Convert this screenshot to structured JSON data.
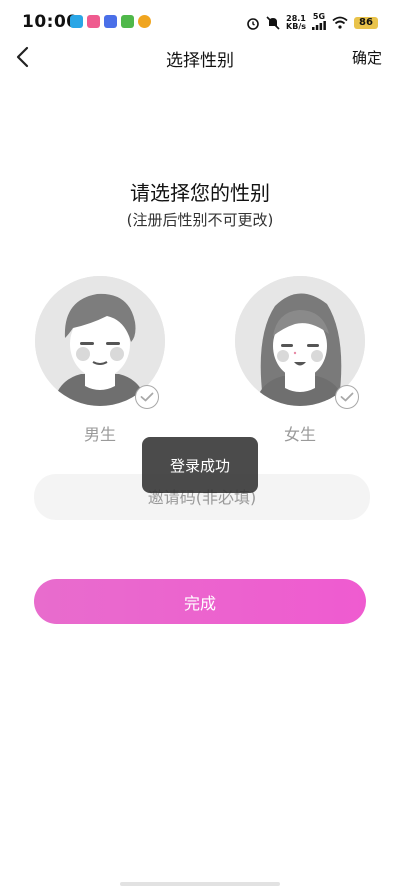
{
  "status_bar": {
    "time": "10:00",
    "network_speed": "28.1",
    "network_unit": "KB/s",
    "signal_type": "5G",
    "battery": "86",
    "battery_color": "#e9c34b"
  },
  "nav": {
    "title": "选择性别",
    "confirm_label": "确定"
  },
  "main": {
    "heading": "请选择您的性别",
    "subheading": "(注册后性别不可更改)",
    "options": [
      {
        "label": "男生",
        "icon": "male-avatar-icon"
      },
      {
        "label": "女生",
        "icon": "female-avatar-icon"
      }
    ],
    "invite_placeholder": "邀请码(非必填)",
    "submit_label": "完成"
  },
  "toast": {
    "message": "登录成功"
  },
  "colors": {
    "accent_start": "#e86ccd",
    "accent_end": "#ef5bd0",
    "avatar_bg": "#e6e6e6"
  }
}
